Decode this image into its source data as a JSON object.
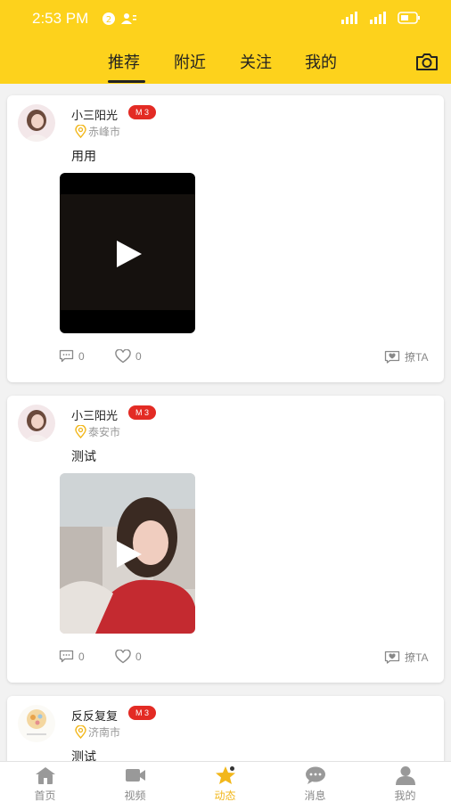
{
  "status_bar": {
    "time": "2:53 PM"
  },
  "tabs": [
    {
      "label": "推荐",
      "active": true
    },
    {
      "label": "附近",
      "active": false
    },
    {
      "label": "关注",
      "active": false
    },
    {
      "label": "我的",
      "active": false
    }
  ],
  "posts": [
    {
      "username": "小三阳光",
      "level": "M 3",
      "location": "赤峰市",
      "text": "用用",
      "comments": "0",
      "likes": "0",
      "chat_label": "撩TA"
    },
    {
      "username": "小三阳光",
      "level": "M 3",
      "location": "泰安市",
      "text": "测试",
      "comments": "0",
      "likes": "0",
      "chat_label": "撩TA"
    },
    {
      "username": "反反复复",
      "level": "M 3",
      "location": "济南市",
      "text": "测试"
    }
  ],
  "bottom_nav": [
    {
      "label": "首页",
      "icon": "home-icon",
      "active": false
    },
    {
      "label": "视频",
      "icon": "video-camera-icon",
      "active": false
    },
    {
      "label": "动态",
      "icon": "star-icon",
      "active": true
    },
    {
      "label": "消息",
      "icon": "message-icon",
      "active": false
    },
    {
      "label": "我的",
      "icon": "person-icon",
      "active": false
    }
  ],
  "colors": {
    "brand_yellow": "#fdd21c",
    "badge_red": "#e32b24",
    "active_nav": "#f2b71b"
  }
}
